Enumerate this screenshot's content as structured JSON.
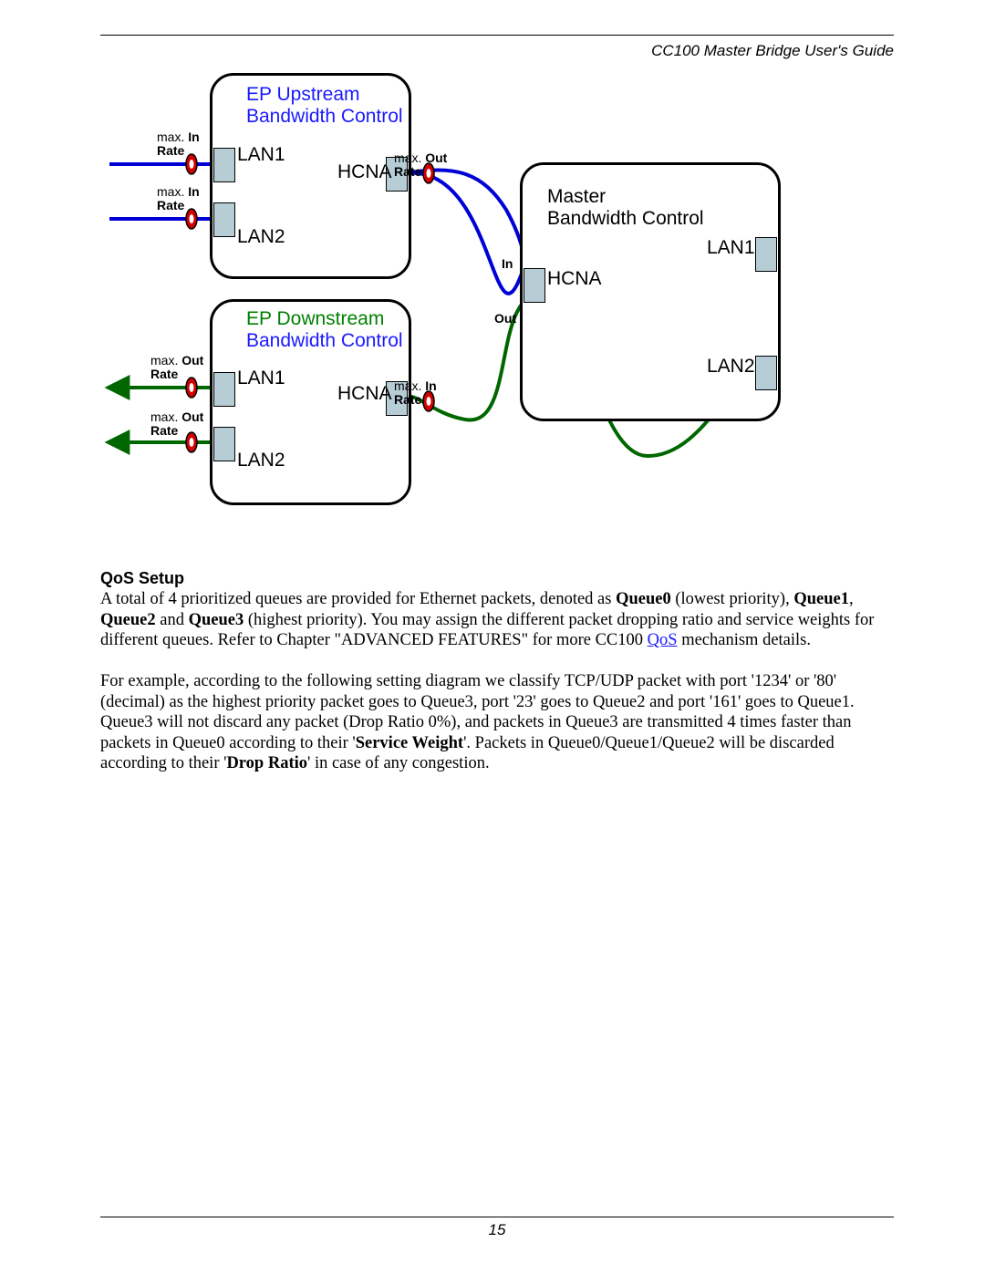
{
  "header": {
    "title": "CC100 Master Bridge User's Guide"
  },
  "diagram": {
    "upstream": {
      "title_a": "EP Upstream",
      "title_b": "Bandwidth Control",
      "lan1": "LAN1",
      "lan2": "LAN2",
      "hcna": "HCNA",
      "maxin_lan1": "max.",
      "maxin_lan1_b": "In",
      "rate_lan1": "Rate",
      "maxin_lan2": "max.",
      "maxin_lan2_b": "In",
      "rate_lan2": "Rate",
      "maxout": "max.",
      "maxout_b": "Out",
      "maxout_rate": "Rate"
    },
    "downstream": {
      "title_a": "EP Downstream",
      "title_b": "Bandwidth Control",
      "lan1": "LAN1",
      "lan2": "LAN2",
      "hcna": "HCNA",
      "maxout_lan1": "max.",
      "maxout_lan1_b": "Out",
      "rate_lan1": "Rate",
      "maxout_lan2": "max.",
      "maxout_lan2_b": "Out",
      "rate_lan2": "Rate",
      "maxin": "max.",
      "maxin_b": "In",
      "maxin_rate": "Rate"
    },
    "master": {
      "title_a": "Master",
      "title_b": "Bandwidth Control",
      "lan1": "LAN1",
      "lan2": "LAN2",
      "hcna": "HCNA",
      "in": "In",
      "out": "Out"
    }
  },
  "qos": {
    "heading": "QoS Setup",
    "p1_a": "A total of 4 prioritized queues are provided for Ethernet packets, denoted as ",
    "p1_q0": "Queue0",
    "p1_b": " (lowest priority), ",
    "p1_q1": "Queue1",
    "p1_c": ", ",
    "p1_q2": "Queue2",
    "p1_d": " and ",
    "p1_q3": "Queue3",
    "p1_e": " (highest priority). You may assign the different packet dropping ratio and service weights for different queues. Refer to Chapter \"ADVANCED FEATURES\" for more CC100 ",
    "p1_link": "QoS",
    "p1_f": " mechanism details.",
    "p2_a": "For example, according to the following setting diagram we classify TCP/UDP packet with port '1234' or '80' (decimal) as the highest priority packet goes to Queue3, port '23' goes to Queue2 and port '161' goes to Queue1. Queue3 will not discard any packet (Drop Ratio 0%), and packets in Queue3 are transmitted 4 times faster than packets in Queue0 according to their '",
    "p2_sw": "Service Weight",
    "p2_b": "'. Packets in Queue0/Queue1/Queue2 will be discarded according to their '",
    "p2_dr": "Drop Ratio",
    "p2_c": "' in case of any congestion."
  },
  "footer": {
    "page": "15"
  }
}
